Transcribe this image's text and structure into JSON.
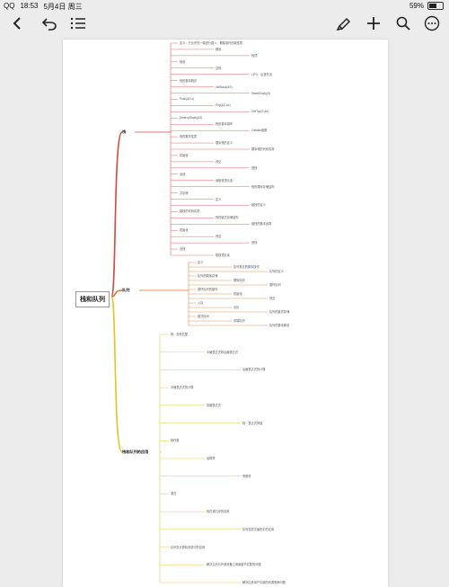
{
  "status_bar": {
    "carrier": "QQ",
    "time": "18:53",
    "date": "5月4日 周三",
    "battery_percent": "59%",
    "battery_level": 0.59
  },
  "toolbar": {
    "back_icon": "chevron-left-icon",
    "undo_icon": "undo-icon",
    "list_icon": "list-icon",
    "highlighter_icon": "highlighter-icon",
    "add_icon": "plus-icon",
    "search_icon": "search-icon",
    "more_icon": "more-icon"
  },
  "mindmap": {
    "root": "栈和队列",
    "branches": [
      {
        "label": "栈",
        "color": "#d9463b"
      },
      {
        "label": "队列",
        "color": "#e0732c"
      },
      {
        "label": "栈和队列的应用",
        "color": "#e8c021"
      }
    ],
    "stack_nodes": [
      "定义：只允许在一端进行插入、删除操作的线性表",
      "顺序",
      "栈顶",
      "栈底",
      "空栈",
      "LIFO：后进先出",
      "栈的基本概念",
      "InitStack(&S)",
      "StackEmpty(S)",
      "Push(&S,x)",
      "Pop(&S,&x)",
      "GetTop(S,&x)",
      "DestroyStack(&S)",
      "栈的基本操作",
      "Catalan函数",
      "栈的数学性质",
      "顺序栈的定义",
      "顺序栈的代码实现",
      "初始化",
      "判空",
      "进栈",
      "出栈",
      "读取栈顶元素",
      "栈的顺序存储结构",
      "共享栈",
      "定义",
      "链栈的定义",
      "链栈的代码实现",
      "栈的链式存储结构",
      "链栈的基本运算",
      "初始化",
      "判空",
      "进栈",
      "出栈",
      "取栈顶元素"
    ],
    "queue_nodes": [
      "定义",
      "队列常见的基本操作",
      "队列的定义",
      "队列的顺序存储",
      "顺序队列",
      "循环队列",
      "循环队列的操作",
      "初始化",
      "判空",
      "入队",
      "出队",
      "队列的链式存储",
      "链式队列",
      "双端队列",
      "队列的基本概念"
    ],
    "application_nodes": [
      "栈：括号匹配",
      "中缀表达式转后缀表达式",
      "后缀表达式的计算",
      "中缀表达式的计算",
      "前缀表达式",
      "栈：表达式求值",
      "操作数",
      "运算符",
      "界限符",
      "递归",
      "栈在递归中的应用",
      "队列在层次遍历中的应用",
      "队列在计算机系统中的应用",
      "解决主机与外部设备之间速度不匹配的问题",
      "解决由多用户引起的资源竞争问题"
    ]
  }
}
